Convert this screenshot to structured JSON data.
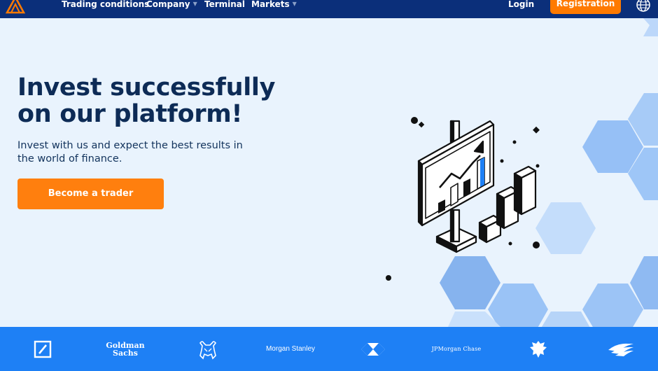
{
  "colors": {
    "navbar": "#0b2f7a",
    "accent": "#ff7a00",
    "hero_bg": "#e9f3fd",
    "headline": "#0d2b56",
    "partner_bar": "#1e80f5"
  },
  "nav": {
    "logo": "triangle-logo-icon",
    "items": [
      {
        "label": "Trading conditions",
        "has_dropdown": false
      },
      {
        "label": "Company",
        "has_dropdown": true
      },
      {
        "label": "Terminal",
        "has_dropdown": false
      },
      {
        "label": "Markets",
        "has_dropdown": true
      }
    ],
    "login": "Login",
    "register": "Registration",
    "language_icon": "globe-icon"
  },
  "hero": {
    "title_line1": "Invest successfully",
    "title_line2": "on our platform!",
    "subtitle": "Invest with us and expect the best results in the world of finance.",
    "cta": "Become a trader",
    "illustration": "chart-presentation-illustration"
  },
  "partners": [
    {
      "name": "deutsche-bank",
      "icon": "deutsche-bank-logo"
    },
    {
      "name": "goldman-sachs",
      "line1": "Goldman",
      "line2": "Sachs"
    },
    {
      "name": "merrill-lynch",
      "icon": "bull-logo"
    },
    {
      "name": "morgan-stanley",
      "label": "Morgan Stanley"
    },
    {
      "name": "hsbc",
      "icon": "hsbc-hexagon-logo"
    },
    {
      "name": "jpmorgan-chase",
      "label": "JPMorgan Chase"
    },
    {
      "name": "barclays",
      "icon": "eagle-logo"
    },
    {
      "name": "bank-of-america",
      "icon": "flag-logo"
    }
  ]
}
